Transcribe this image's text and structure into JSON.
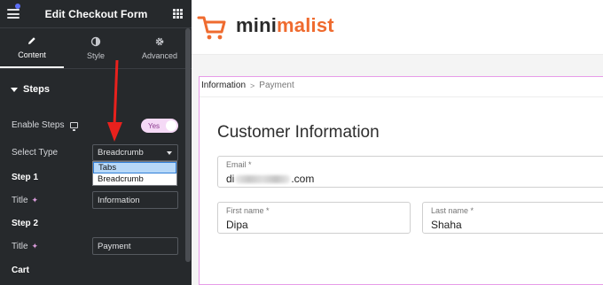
{
  "panel": {
    "title": "Edit Checkout Form",
    "tabs": [
      {
        "label": "Content",
        "icon": "pencil-icon",
        "active": true
      },
      {
        "label": "Style",
        "icon": "half-circle-icon",
        "active": false
      },
      {
        "label": "Advanced",
        "icon": "gear-icon",
        "active": false
      }
    ],
    "section_title": "Steps",
    "enable_steps_label": "Enable Steps",
    "enable_steps_toggle": "Yes",
    "select_type_label": "Select Type",
    "select_type_value": "Breadcrumb",
    "select_type_options": [
      "Tabs",
      "Breadcrumb"
    ],
    "highlighted_option": "Tabs",
    "step1_heading": "Step 1",
    "step1_title_label": "Title",
    "step1_title_value": "Information",
    "step2_heading": "Step 2",
    "step2_title_label": "Title",
    "step2_title_value": "Payment",
    "cart_heading": "Cart",
    "collapse_glyph": "‹"
  },
  "preview": {
    "brand_part1": "mini",
    "brand_part2": "malist",
    "brand_color": "#ef6b2f",
    "breadcrumb": {
      "step1": "Information",
      "separator": ">",
      "step2": "Payment"
    },
    "heading": "Customer Information",
    "email": {
      "label": "Email *",
      "value_prefix": "di",
      "value_suffix": ".com"
    },
    "first_name": {
      "label": "First name *",
      "value": "Dipa"
    },
    "last_name": {
      "label": "Last name *",
      "value": "Shaha"
    }
  },
  "colors": {
    "panel_bg": "#26292c",
    "toggle_bg": "#f5d9f6",
    "selection_outline": "#e79ce8",
    "annotation_arrow": "#e8211d"
  }
}
